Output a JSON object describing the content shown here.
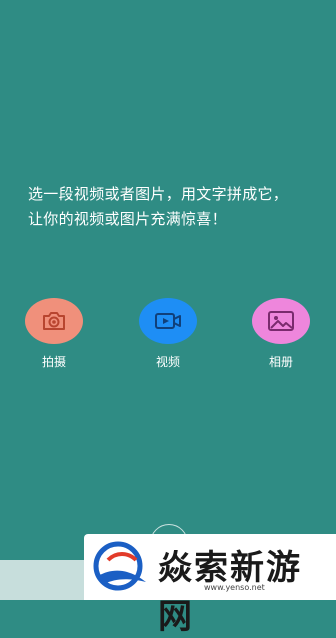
{
  "intro": {
    "line1": "选一段视频或者图片，用文字拼成它，",
    "line2": "让你的视频或图片充满惊喜！"
  },
  "actions": [
    {
      "label": "拍摄",
      "icon": "camera-icon",
      "color": "#f0907b"
    },
    {
      "label": "视频",
      "icon": "video-icon",
      "color": "#1e8ef5"
    },
    {
      "label": "相册",
      "icon": "image-icon",
      "color": "#ee86dc"
    }
  ],
  "watermark": {
    "name": "焱索新游网",
    "url": "www.yenso.net"
  },
  "colors": {
    "background": "#2f8c84",
    "bottom_strip": "#c7dedc"
  }
}
